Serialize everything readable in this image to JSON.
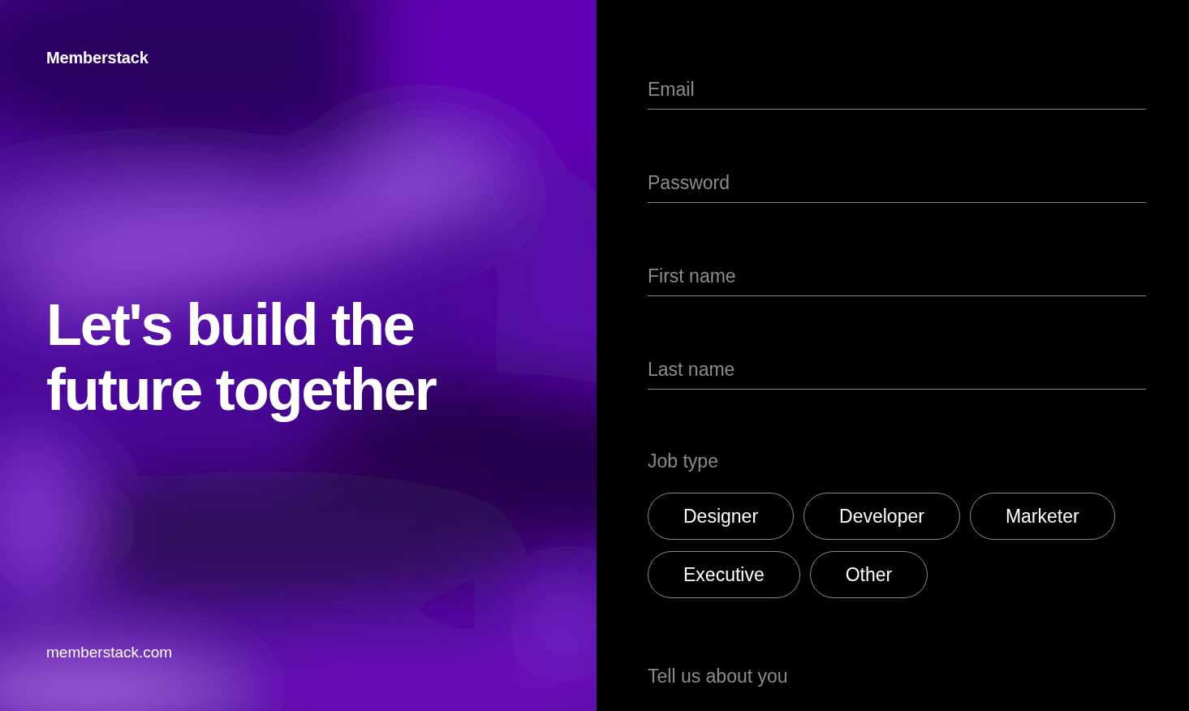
{
  "brand": {
    "name": "Memberstack",
    "url": "memberstack.com"
  },
  "hero": {
    "headline": "Let's build the future together"
  },
  "form": {
    "fields": [
      {
        "placeholder": "Email"
      },
      {
        "placeholder": "Password"
      },
      {
        "placeholder": "First name"
      },
      {
        "placeholder": "Last name"
      }
    ],
    "job_type": {
      "label": "Job type",
      "options": [
        {
          "label": "Designer",
          "selected": false
        },
        {
          "label": "Developer",
          "selected": false
        },
        {
          "label": "Marketer",
          "selected": false
        },
        {
          "label": "Executive",
          "selected": false
        },
        {
          "label": "Other",
          "selected": false
        }
      ]
    },
    "about": {
      "placeholder": "Tell us about you"
    }
  }
}
